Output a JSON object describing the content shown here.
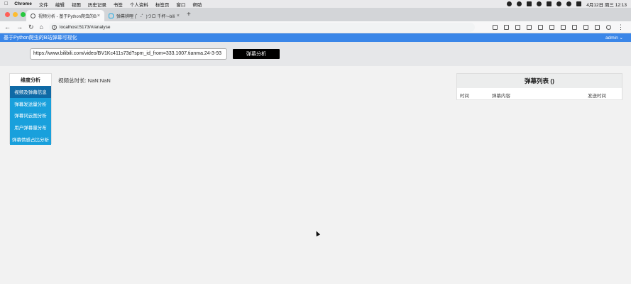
{
  "menubar": {
    "app_name": "Chrome",
    "items": [
      "文件",
      "编辑",
      "视图",
      "历史记录",
      "书签",
      "个人资料",
      "标签页",
      "窗口",
      "帮助"
    ],
    "clock": "4月12日 周三  12:13"
  },
  "tabs": [
    {
      "label": "视频分析 - 基于Python爬虫的B",
      "close": "×"
    },
    {
      "label": "弹幕辨哩 (゜-゜)つロ 千杯~-bili",
      "close": "×"
    }
  ],
  "browser": {
    "url": "localhost:5173/#/analyse",
    "new_tab": "+"
  },
  "header": {
    "title": "基于Python爬虫的B站弹幕可视化",
    "user": "admin ⌄"
  },
  "search": {
    "url_value": "https://www.bilibili.com/video/BV1Kc411s73d?spm_id_from=333.1007.tianma.24-3-93",
    "button_label": "弹幕分析"
  },
  "sidebar": {
    "heading": "维度分析",
    "items": [
      "视频及弹幕信息",
      "弹幕发送量分析",
      "弹幕词云图分析",
      "用户弹幕量分布",
      "弹幕情感占比分析"
    ]
  },
  "main": {
    "duration_text": "视频总时长: NaN:NaN"
  },
  "danmaku_list": {
    "title": "弹幕列表 ()",
    "columns": [
      "时间",
      "弹幕内容",
      "发送时间"
    ]
  },
  "colors": {
    "header_bg": "#3a86e8",
    "sidebar_item": "#19a0dc",
    "sidebar_item_active": "#0f6aa6"
  }
}
